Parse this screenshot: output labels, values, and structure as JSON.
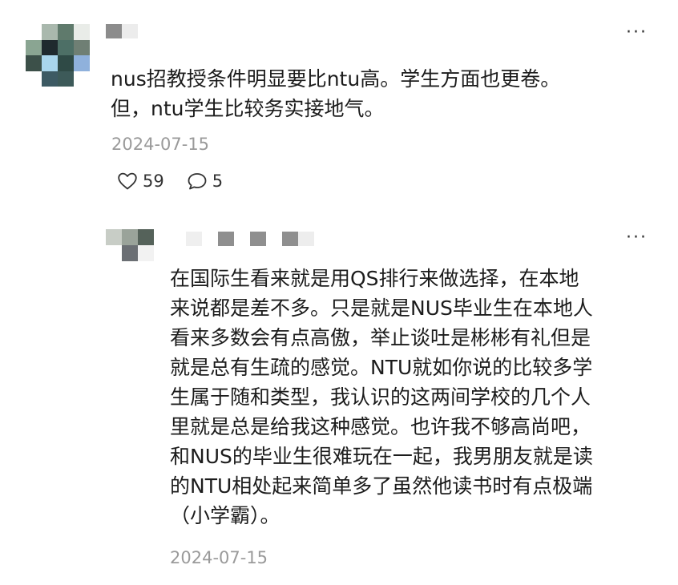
{
  "comments": [
    {
      "text": "nus招教授条件明显要比ntu高。学生方面也更卷。\n但，ntu学生比较务实接地气。",
      "date": "2024-07-15",
      "likes": "59",
      "replies": "5",
      "more_label": "···"
    },
    {
      "text": "在国际生看来就是用QS排行来做选择，在本地\n来说都是差不多。只是就是NUS毕业生在本地人\n看来多数会有点高傲，举止谈吐是彬彬有礼但是\n就是总有生疏的感觉。NTU就如你说的比较多学\n生属于随和类型，我认识的这两间学校的几个人\n里就是总是给我这种感觉。也许我不够高尚吧，\n和NUS的毕业生很难玩在一起，我男朋友就是读\n的NTU相处起来简单多了虽然他读书时有点极端\n（小学霸）。",
      "date": "2024-07-15",
      "more_label": "···"
    }
  ],
  "icons": {
    "like": "heart-outline-icon",
    "reply": "speech-bubble-icon",
    "more": "more-dots-icon"
  },
  "colors": {
    "text": "#1c1c1c",
    "meta": "#9a9a9a",
    "background": "#ffffff"
  }
}
